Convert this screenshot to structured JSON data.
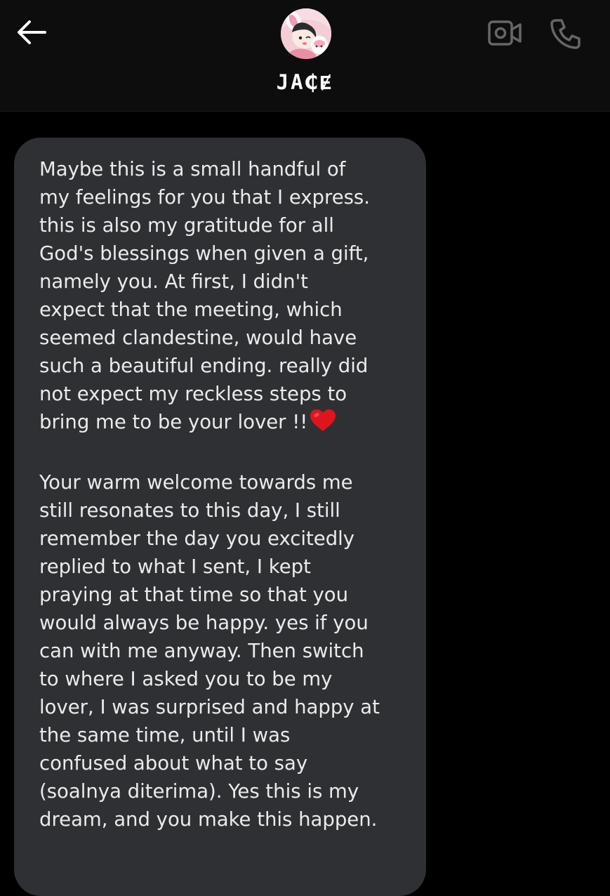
{
  "header": {
    "contact_name": "JA₵Ɇ",
    "back_icon": "arrow-left-icon",
    "video_icon": "video-camera-icon",
    "call_icon": "phone-icon"
  },
  "conversation": {
    "bubble_color": "#2f3033",
    "message": {
      "paragraph_1": "Maybe this is a small handful of\nmy feelings for you that I express.\nthis is also my gratitude for all\nGod's blessings when given a gift,\nnamely you.  At first, I didn't\nexpect that the meeting, which\nseemed clandestine, would have\nsuch a beautiful ending. really did\nnot expect my reckless steps to\nbring me to be your lover !!",
      "emoji": "red-heart-icon",
      "paragraph_2": "Your warm welcome towards me\nstill resonates to this day, I still\nremember the day you excitedly\nreplied to what I sent, I kept\npraying at that time so that you\nwould always be happy. yes if you\ncan with me anyway.  Then switch\nto where I asked you to be my\nlover, I was surprised and happy at\nthe same time, until I was\nconfused about what to say\n(soalnya diterima). Yes this is my\ndream, and you make this happen."
    }
  }
}
